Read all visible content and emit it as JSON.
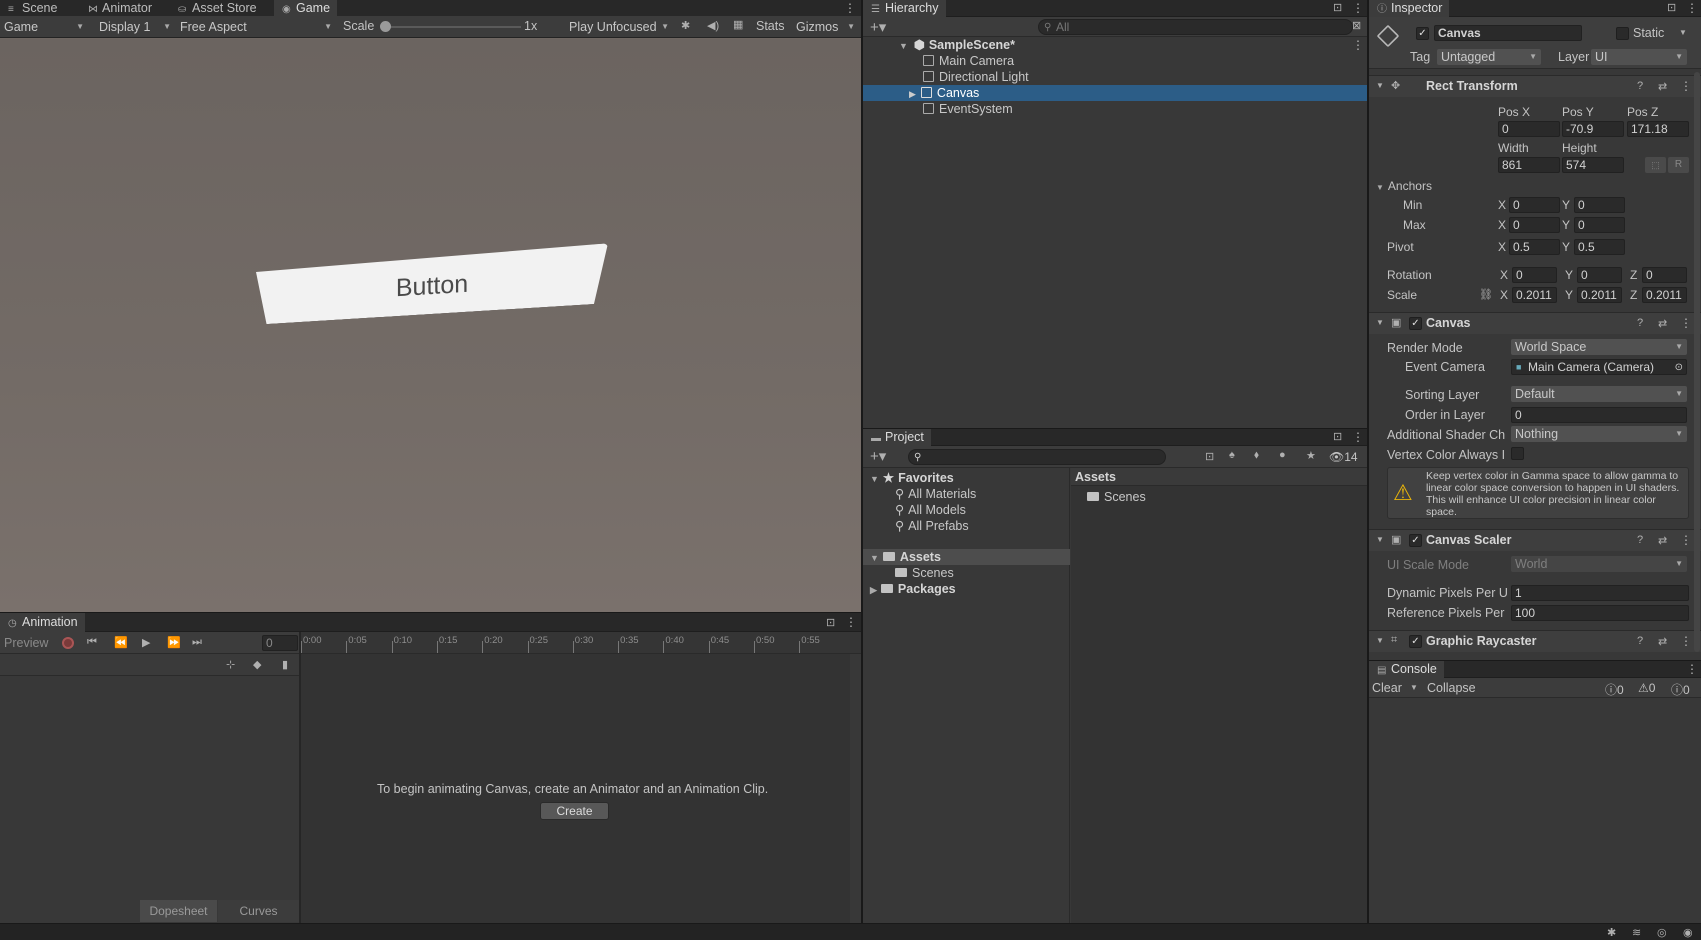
{
  "game": {
    "tabs": [
      {
        "icon": "≡",
        "label": "Scene"
      },
      {
        "icon": "⋈",
        "label": "Animator"
      },
      {
        "icon": "⛀",
        "label": "Asset Store"
      },
      {
        "icon": "◉",
        "label": "Game"
      }
    ],
    "mode": "Game",
    "display": "Display 1",
    "aspect": "Free Aspect",
    "scale_label": "Scale",
    "scale_value": "1x",
    "play_mode": "Play Unfocused",
    "stats": "Stats",
    "gizmos": "Gizmos",
    "button_text": "Button"
  },
  "animation": {
    "tab": "Animation",
    "preview": "Preview",
    "frame": "0",
    "ticks": [
      "0:00",
      "0:05",
      "0:10",
      "0:15",
      "0:20",
      "0:25",
      "0:30",
      "0:35",
      "0:40",
      "0:45",
      "0:50",
      "0:55"
    ],
    "message": "To begin animating Canvas, create an Animator and an Animation Clip.",
    "create": "Create",
    "dopesheet": "Dopesheet",
    "curves": "Curves"
  },
  "hierarchy": {
    "tab": "Hierarchy",
    "search_placeholder": "All",
    "scene": "SampleScene*",
    "items": [
      "Main Camera",
      "Directional Light",
      "Canvas",
      "EventSystem"
    ]
  },
  "project": {
    "tab": "Project",
    "count": "14",
    "favorites": "Favorites",
    "fav_items": [
      "All Materials",
      "All Models",
      "All Prefabs"
    ],
    "assets": "Assets",
    "scenes": "Scenes",
    "packages": "Packages",
    "breadcrumb": "Assets",
    "content": [
      "Scenes"
    ]
  },
  "inspector": {
    "tab": "Inspector",
    "object_name": "Canvas",
    "static": "Static",
    "tag_label": "Tag",
    "tag": "Untagged",
    "layer_label": "Layer",
    "layer": "UI",
    "rect": {
      "title": "Rect Transform",
      "posx_l": "Pos X",
      "posy_l": "Pos Y",
      "posz_l": "Pos Z",
      "posx": "0",
      "posy": "-70.9",
      "posz": "171.18",
      "width_l": "Width",
      "height_l": "Height",
      "width": "861",
      "height": "574",
      "r": "R",
      "anchors": "Anchors",
      "min": "Min",
      "max": "Max",
      "pivot": "Pivot",
      "x": "X",
      "y": "Y",
      "z": "Z",
      "min_x": "0",
      "min_y": "0",
      "max_x": "0",
      "max_y": "0",
      "pivot_x": "0.5",
      "pivot_y": "0.5",
      "rotation": "Rotation",
      "rot_x": "0",
      "rot_y": "0",
      "rot_z": "0",
      "scale": "Scale",
      "scale_x": "0.2011",
      "scale_y": "0.2011",
      "scale_z": "0.2011"
    },
    "canvas": {
      "title": "Canvas",
      "render_mode_l": "Render Mode",
      "render_mode": "World Space",
      "event_camera_l": "Event Camera",
      "event_camera": "Main Camera (Camera)",
      "sorting_layer_l": "Sorting Layer",
      "sorting_layer": "Default",
      "order_l": "Order in Layer",
      "order": "0",
      "shader_l": "Additional Shader Ch",
      "shader": "Nothing",
      "vertex_l": "Vertex Color Always I",
      "warning": "Keep vertex color in Gamma space to allow gamma to linear color space conversion to happen in UI shaders. This will enhance UI color precision in linear color space."
    },
    "scaler": {
      "title": "Canvas Scaler",
      "mode_l": "UI Scale Mode",
      "mode": "World",
      "dyn_l": "Dynamic Pixels Per U",
      "dyn": "1",
      "ref_l": "Reference Pixels Per",
      "ref": "100"
    },
    "raycaster": {
      "title": "Graphic Raycaster"
    }
  },
  "console": {
    "tab": "Console",
    "clear": "Clear",
    "collapse": "Collapse",
    "logs": "0",
    "warnings": "0",
    "errors": "0"
  },
  "colors": {
    "selection": "#2c5d87",
    "game_bg": "#6e6661"
  }
}
